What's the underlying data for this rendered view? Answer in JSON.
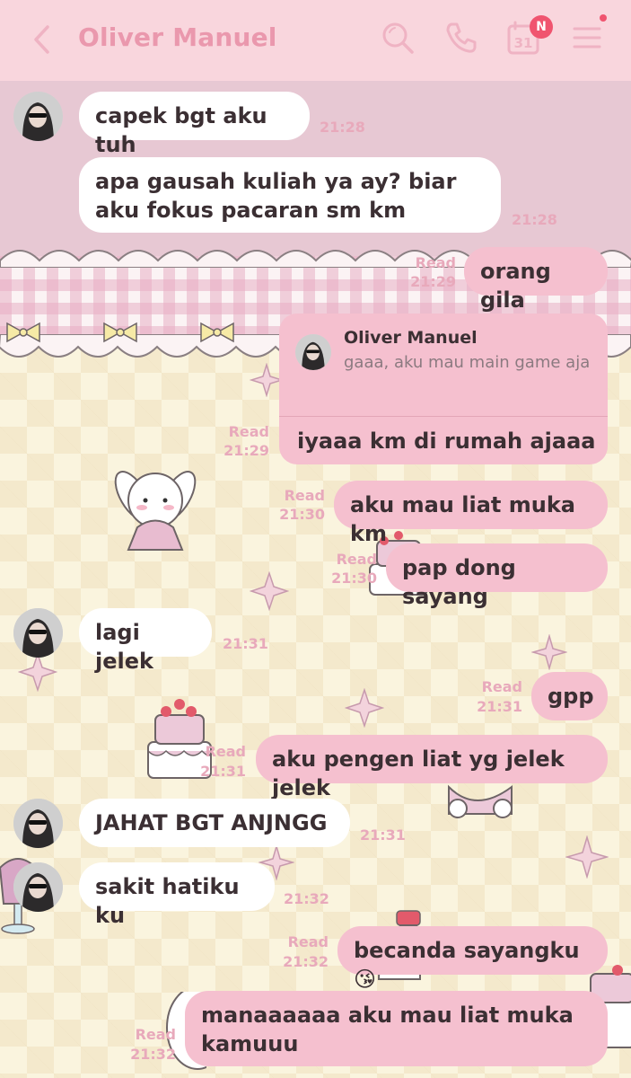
{
  "header": {
    "contact_name": "Oliver Manuel",
    "calendar_day": "31",
    "badge_label": "N",
    "accent_color": "#ea98ad",
    "background_color": "#f9d6dd"
  },
  "messages": [
    {
      "from": "them",
      "text": "capek bgt aku tuh",
      "time": "21:28"
    },
    {
      "from": "them",
      "text": "apa gausah kuliah ya ay? biar aku fokus pacaran sm km",
      "time": "21:28"
    },
    {
      "from": "me",
      "text": "orang gila",
      "read": "Read",
      "time": "21:29"
    },
    {
      "from": "me",
      "reply_to": {
        "name": "Oliver Manuel",
        "text": "gaaa, aku mau main game aja"
      },
      "text": "iyaaa km di rumah ajaaa ay",
      "read": "Read",
      "time": "21:29"
    },
    {
      "from": "me",
      "text": "aku mau liat muka km",
      "read": "Read",
      "time": "21:30"
    },
    {
      "from": "me",
      "text": "pap dong sayang",
      "read": "Read",
      "time": "21:30"
    },
    {
      "from": "them",
      "text": "lagi jelek",
      "time": "21:31"
    },
    {
      "from": "me",
      "text": "gpp",
      "read": "Read",
      "time": "21:31"
    },
    {
      "from": "me",
      "text": "aku pengen liat yg jelek jelek",
      "read": "Read",
      "time": "21:31"
    },
    {
      "from": "them",
      "text": "JAHAT BGT ANJNGG",
      "time": "21:31"
    },
    {
      "from": "them",
      "text": "sakit hatiku ku",
      "time": "21:32"
    },
    {
      "from": "me",
      "text": "becanda sayangku😘",
      "read": "Read",
      "time": "21:32"
    },
    {
      "from": "me",
      "text": "manaaaaaa aku mau liat muka kamuuu",
      "read": "Read",
      "time": "21:32"
    }
  ]
}
